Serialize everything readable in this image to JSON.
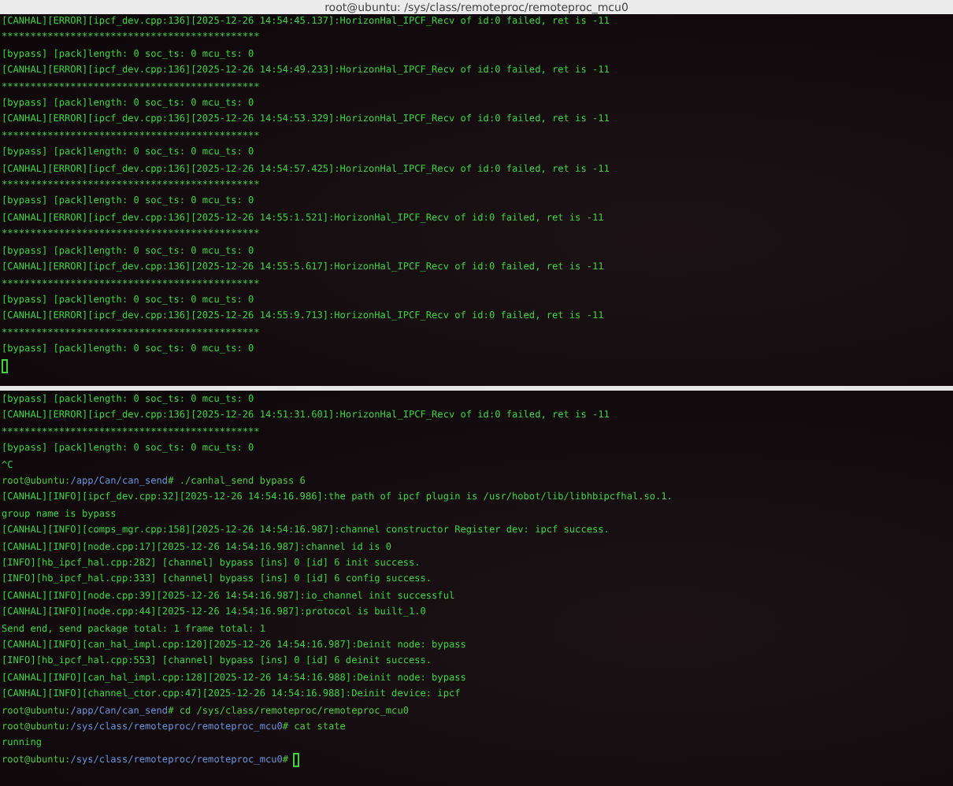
{
  "window": {
    "title": "root@ubuntu: /sys/class/remoteproc/remoteproc_mcu0"
  },
  "panes": [
    {
      "lines": [
        {
          "kind": "output",
          "text": "[CANHAL][ERROR][ipcf_dev.cpp:136][2025-12-26 14:54:45.137]:HorizonHal_IPCF_Recv of id:0 failed, ret is -11"
        },
        {
          "kind": "output",
          "text": "*********************************************"
        },
        {
          "kind": "output",
          "text": "[bypass] [pack]length: 0 soc_ts: 0 mcu_ts: 0"
        },
        {
          "kind": "output",
          "text": "[CANHAL][ERROR][ipcf_dev.cpp:136][2025-12-26 14:54:49.233]:HorizonHal_IPCF_Recv of id:0 failed, ret is -11"
        },
        {
          "kind": "output",
          "text": "*********************************************"
        },
        {
          "kind": "output",
          "text": "[bypass] [pack]length: 0 soc_ts: 0 mcu_ts: 0"
        },
        {
          "kind": "output",
          "text": "[CANHAL][ERROR][ipcf_dev.cpp:136][2025-12-26 14:54:53.329]:HorizonHal_IPCF_Recv of id:0 failed, ret is -11"
        },
        {
          "kind": "output",
          "text": "*********************************************"
        },
        {
          "kind": "output",
          "text": "[bypass] [pack]length: 0 soc_ts: 0 mcu_ts: 0"
        },
        {
          "kind": "output",
          "text": "[CANHAL][ERROR][ipcf_dev.cpp:136][2025-12-26 14:54:57.425]:HorizonHal_IPCF_Recv of id:0 failed, ret is -11"
        },
        {
          "kind": "output",
          "text": "*********************************************"
        },
        {
          "kind": "output",
          "text": "[bypass] [pack]length: 0 soc_ts: 0 mcu_ts: 0"
        },
        {
          "kind": "output",
          "text": "[CANHAL][ERROR][ipcf_dev.cpp:136][2025-12-26 14:55:1.521]:HorizonHal_IPCF_Recv of id:0 failed, ret is -11"
        },
        {
          "kind": "output",
          "text": "*********************************************"
        },
        {
          "kind": "output",
          "text": "[bypass] [pack]length: 0 soc_ts: 0 mcu_ts: 0"
        },
        {
          "kind": "output",
          "text": "[CANHAL][ERROR][ipcf_dev.cpp:136][2025-12-26 14:55:5.617]:HorizonHal_IPCF_Recv of id:0 failed, ret is -11"
        },
        {
          "kind": "output",
          "text": "*********************************************"
        },
        {
          "kind": "output",
          "text": "[bypass] [pack]length: 0 soc_ts: 0 mcu_ts: 0"
        },
        {
          "kind": "output",
          "text": "[CANHAL][ERROR][ipcf_dev.cpp:136][2025-12-26 14:55:9.713]:HorizonHal_IPCF_Recv of id:0 failed, ret is -11"
        },
        {
          "kind": "output",
          "text": "*********************************************"
        },
        {
          "kind": "output",
          "text": "[bypass] [pack]length: 0 soc_ts: 0 mcu_ts: 0"
        },
        {
          "kind": "cursor"
        }
      ]
    },
    {
      "lines": [
        {
          "kind": "output",
          "text": "[bypass] [pack]length: 0 soc_ts: 0 mcu_ts: 0"
        },
        {
          "kind": "output",
          "text": "[CANHAL][ERROR][ipcf_dev.cpp:136][2025-12-26 14:51:31.601]:HorizonHal_IPCF_Recv of id:0 failed, ret is -11"
        },
        {
          "kind": "output",
          "text": "*********************************************"
        },
        {
          "kind": "output",
          "text": "[bypass] [pack]length: 0 soc_ts: 0 mcu_ts: 0"
        },
        {
          "kind": "output",
          "text": "^C"
        },
        {
          "kind": "prompt",
          "user": "root@ubuntu:",
          "path": "/app/Can/can_send",
          "symbol": "#",
          "command": "./canhal_send bypass 6",
          "cursor": false
        },
        {
          "kind": "output",
          "text": "[CANHAL][INFO][ipcf_dev.cpp:32][2025-12-26 14:54:16.986]:the path of ipcf plugin is /usr/hobot/lib/libhbipcfhal.so.1."
        },
        {
          "kind": "output",
          "text": "group name is bypass"
        },
        {
          "kind": "output",
          "text": "[CANHAL][INFO][comps_mgr.cpp:158][2025-12-26 14:54:16.987]:channel constructor Register dev: ipcf success."
        },
        {
          "kind": "output",
          "text": "[CANHAL][INFO][node.cpp:17][2025-12-26 14:54:16.987]:channel id is 0"
        },
        {
          "kind": "output",
          "text": "[INFO][hb_ipcf_hal.cpp:282] [channel] bypass [ins] 0 [id] 6 init success."
        },
        {
          "kind": "output",
          "text": "[INFO][hb_ipcf_hal.cpp:333] [channel] bypass [ins] 0 [id] 6 config success."
        },
        {
          "kind": "output",
          "text": "[CANHAL][INFO][node.cpp:39][2025-12-26 14:54:16.987]:io_channel init successful"
        },
        {
          "kind": "output",
          "text": "[CANHAL][INFO][node.cpp:44][2025-12-26 14:54:16.987]:protocol is built_1.0"
        },
        {
          "kind": "output",
          "text": "Send end, send package total: 1 frame total: 1"
        },
        {
          "kind": "output",
          "text": "[CANHAL][INFO][can_hal_impl.cpp:120][2025-12-26 14:54:16.987]:Deinit node: bypass"
        },
        {
          "kind": "output",
          "text": "[INFO][hb_ipcf_hal.cpp:553] [channel] bypass [ins] 0 [id] 6 deinit success."
        },
        {
          "kind": "output",
          "text": "[CANHAL][INFO][can_hal_impl.cpp:128][2025-12-26 14:54:16.988]:Deinit node: bypass"
        },
        {
          "kind": "output",
          "text": "[CANHAL][INFO][channel_ctor.cpp:47][2025-12-26 14:54:16.988]:Deinit device: ipcf"
        },
        {
          "kind": "prompt",
          "user": "root@ubuntu:",
          "path": "/app/Can/can_send",
          "symbol": "#",
          "command": "cd /sys/class/remoteproc/remoteproc_mcu0",
          "cursor": false
        },
        {
          "kind": "prompt",
          "user": "root@ubuntu:",
          "path": "/sys/class/remoteproc/remoteproc_mcu0",
          "symbol": "#",
          "command": "cat state",
          "cursor": false
        },
        {
          "kind": "output",
          "text": "running"
        },
        {
          "kind": "prompt",
          "user": "root@ubuntu:",
          "path": "/sys/class/remoteproc/remoteproc_mcu0",
          "symbol": "#",
          "cursor": true
        }
      ]
    }
  ]
}
